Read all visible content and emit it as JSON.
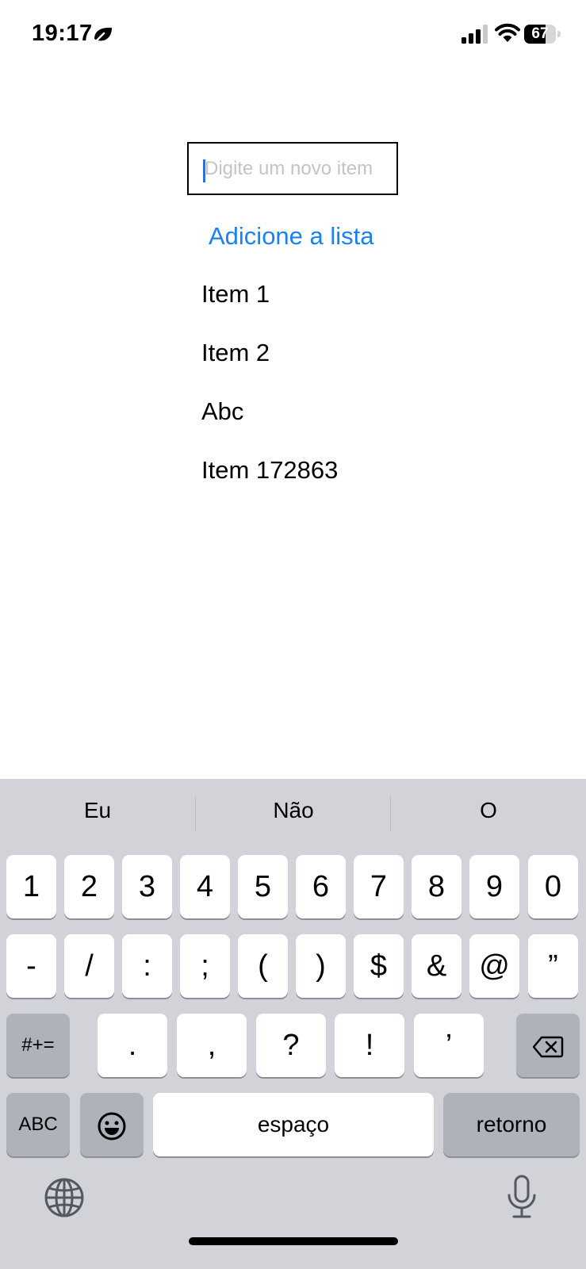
{
  "status_bar": {
    "time": "19:17",
    "battery_level": "67",
    "battery_fraction": 0.67,
    "focus_icon": "leaf-focus-icon",
    "signal_icon": "cellular-signal-icon",
    "wifi_icon": "wifi-icon"
  },
  "form": {
    "input_value": "",
    "input_placeholder": "Digite um novo item",
    "add_button_label": "Adicione a lista",
    "accent_color": "#1a82f0"
  },
  "list": {
    "items": [
      "Item 1",
      "Item 2",
      "Abc",
      "Item 172863"
    ]
  },
  "keyboard": {
    "suggestions": [
      "Eu",
      "Não",
      "O"
    ],
    "row1": [
      "1",
      "2",
      "3",
      "4",
      "5",
      "6",
      "7",
      "8",
      "9",
      "0"
    ],
    "row2": [
      "-",
      "/",
      ":",
      ";",
      "(",
      ")",
      "$",
      "&",
      "@",
      "”"
    ],
    "row3": {
      "symbols_key": "#+=",
      "keys": [
        ".",
        ",",
        "?",
        "!",
        "’"
      ],
      "delete_icon": "backspace-icon"
    },
    "row4": {
      "abc_key": "ABC",
      "emoji_icon": "emoji-icon",
      "space_key": "espaço",
      "return_key": "retorno"
    },
    "globe_icon": "globe-icon",
    "mic_icon": "microphone-icon"
  }
}
